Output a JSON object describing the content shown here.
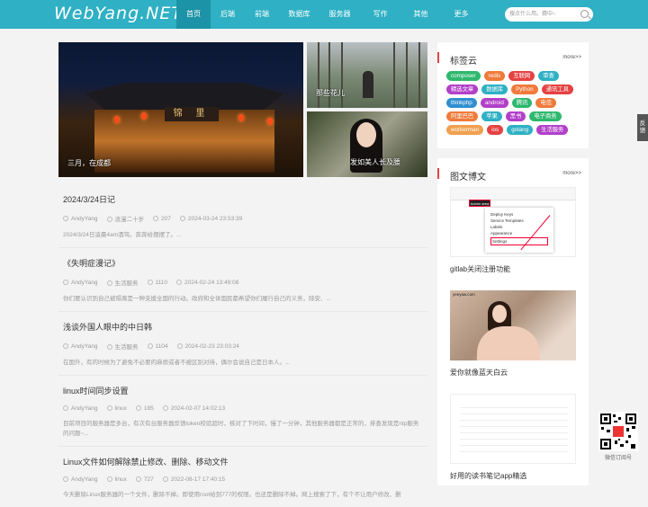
{
  "header": {
    "logo": "WebYang.NET",
    "nav": [
      "首页",
      "后端",
      "前端",
      "数据库",
      "服务器",
      "写作",
      "其他",
      "更多"
    ],
    "search_placeholder": "搜点什么用。猜中~"
  },
  "slides": [
    {
      "caption": "三月，在成都",
      "sign": "锦 里"
    },
    {
      "caption": "那些花儿"
    },
    {
      "caption": "发如美人长及腰"
    }
  ],
  "articles": [
    {
      "title": "2024/3/24日记",
      "author": "AndyYang",
      "category": "浪漫二十岁",
      "views": "207",
      "date": "2024-03-24 23:53:39",
      "excerpt": "2024/3/24日凌晨4am酒驾。奔奔给摆摆了。..."
    },
    {
      "title": "《失明症漫记》",
      "author": "AndyYang",
      "category": "生活服务",
      "views": "1110",
      "date": "2024-02-24 13:49:08",
      "excerpt": "你们要认识到自己被隔离是一种支援全国的行动。政府和全体国民都希望你们履行自己的义务，除安、..."
    },
    {
      "title": "浅谈外国人眼中的中日韩",
      "author": "AndyYang",
      "category": "生活服务",
      "views": "1104",
      "date": "2024-02-23 23:03:24",
      "excerpt": "在国外，有的时候为了避免不必要的麻烦或者不被区别对待，偶尔会说自己是日本人。..."
    },
    {
      "title": "linux时间同步设置",
      "author": "AndyYang",
      "category": "linux",
      "views": "185",
      "date": "2024-02-07 14:02:13",
      "excerpt": "目前项目的服务器是多台，有次有台服务器反馈token校验超时，核对了下时间，慢了一分钟，其他服务器都是正常的，排查发现是ntp服务的问题~..."
    },
    {
      "title": "Linux文件如何解除禁止修改、删除、移动文件",
      "author": "AndyYang",
      "category": "linux",
      "views": "727",
      "date": "2022-08-17 17:40:15",
      "excerpt": "今天删除Linux服务器的一个文件，删除不掉。即使用root给到777的权限。也还是删除不掉。网上搜索了下，有个不让用户修改、删"
    }
  ],
  "tagcloud": {
    "title": "标签云",
    "more": "more>>",
    "tags": [
      {
        "label": "composer",
        "color": "#2eb86e"
      },
      {
        "label": "redis",
        "color": "#f07a3a"
      },
      {
        "label": "互联网",
        "color": "#e54242"
      },
      {
        "label": "审查",
        "color": "#2fb0c4"
      },
      {
        "label": "精选文章",
        "color": "#b23fc9"
      },
      {
        "label": "数据库",
        "color": "#2fb0c4"
      },
      {
        "label": "Python",
        "color": "#f07a3a"
      },
      {
        "label": "通讯工具",
        "color": "#e54242"
      },
      {
        "label": "thinkphp",
        "color": "#2f8fd0"
      },
      {
        "label": "android",
        "color": "#b23fc9"
      },
      {
        "label": "腾讯",
        "color": "#2eb86e"
      },
      {
        "label": "电信",
        "color": "#f07a3a"
      },
      {
        "label": "阿里巴巴",
        "color": "#f07a3a"
      },
      {
        "label": "苹果",
        "color": "#2fb0c4"
      },
      {
        "label": "黑书",
        "color": "#b23fc9"
      },
      {
        "label": "电子商务",
        "color": "#2eb86e"
      },
      {
        "label": "workerman",
        "color": "#f0a050"
      },
      {
        "label": "ios",
        "color": "#e54242"
      },
      {
        "label": "golang",
        "color": "#2fb0c4"
      },
      {
        "label": "生活服务",
        "color": "#b23fc9"
      }
    ]
  },
  "gallery": {
    "title": "图文博文",
    "more": "more>>",
    "posts": [
      {
        "title": "gitlab关闭注册功能",
        "menu": [
          "Admin area",
          "Deploy Keys",
          "Service Templates",
          "Labels",
          "Appearance",
          "Settings"
        ]
      },
      {
        "title": "爱你就像蓝天白云",
        "watermark": "yeeyaw.com"
      },
      {
        "title": "好用的读书笔记app精选"
      }
    ]
  },
  "floating": {
    "feedback": "反馈",
    "qr_caption": "微信订阅号"
  }
}
